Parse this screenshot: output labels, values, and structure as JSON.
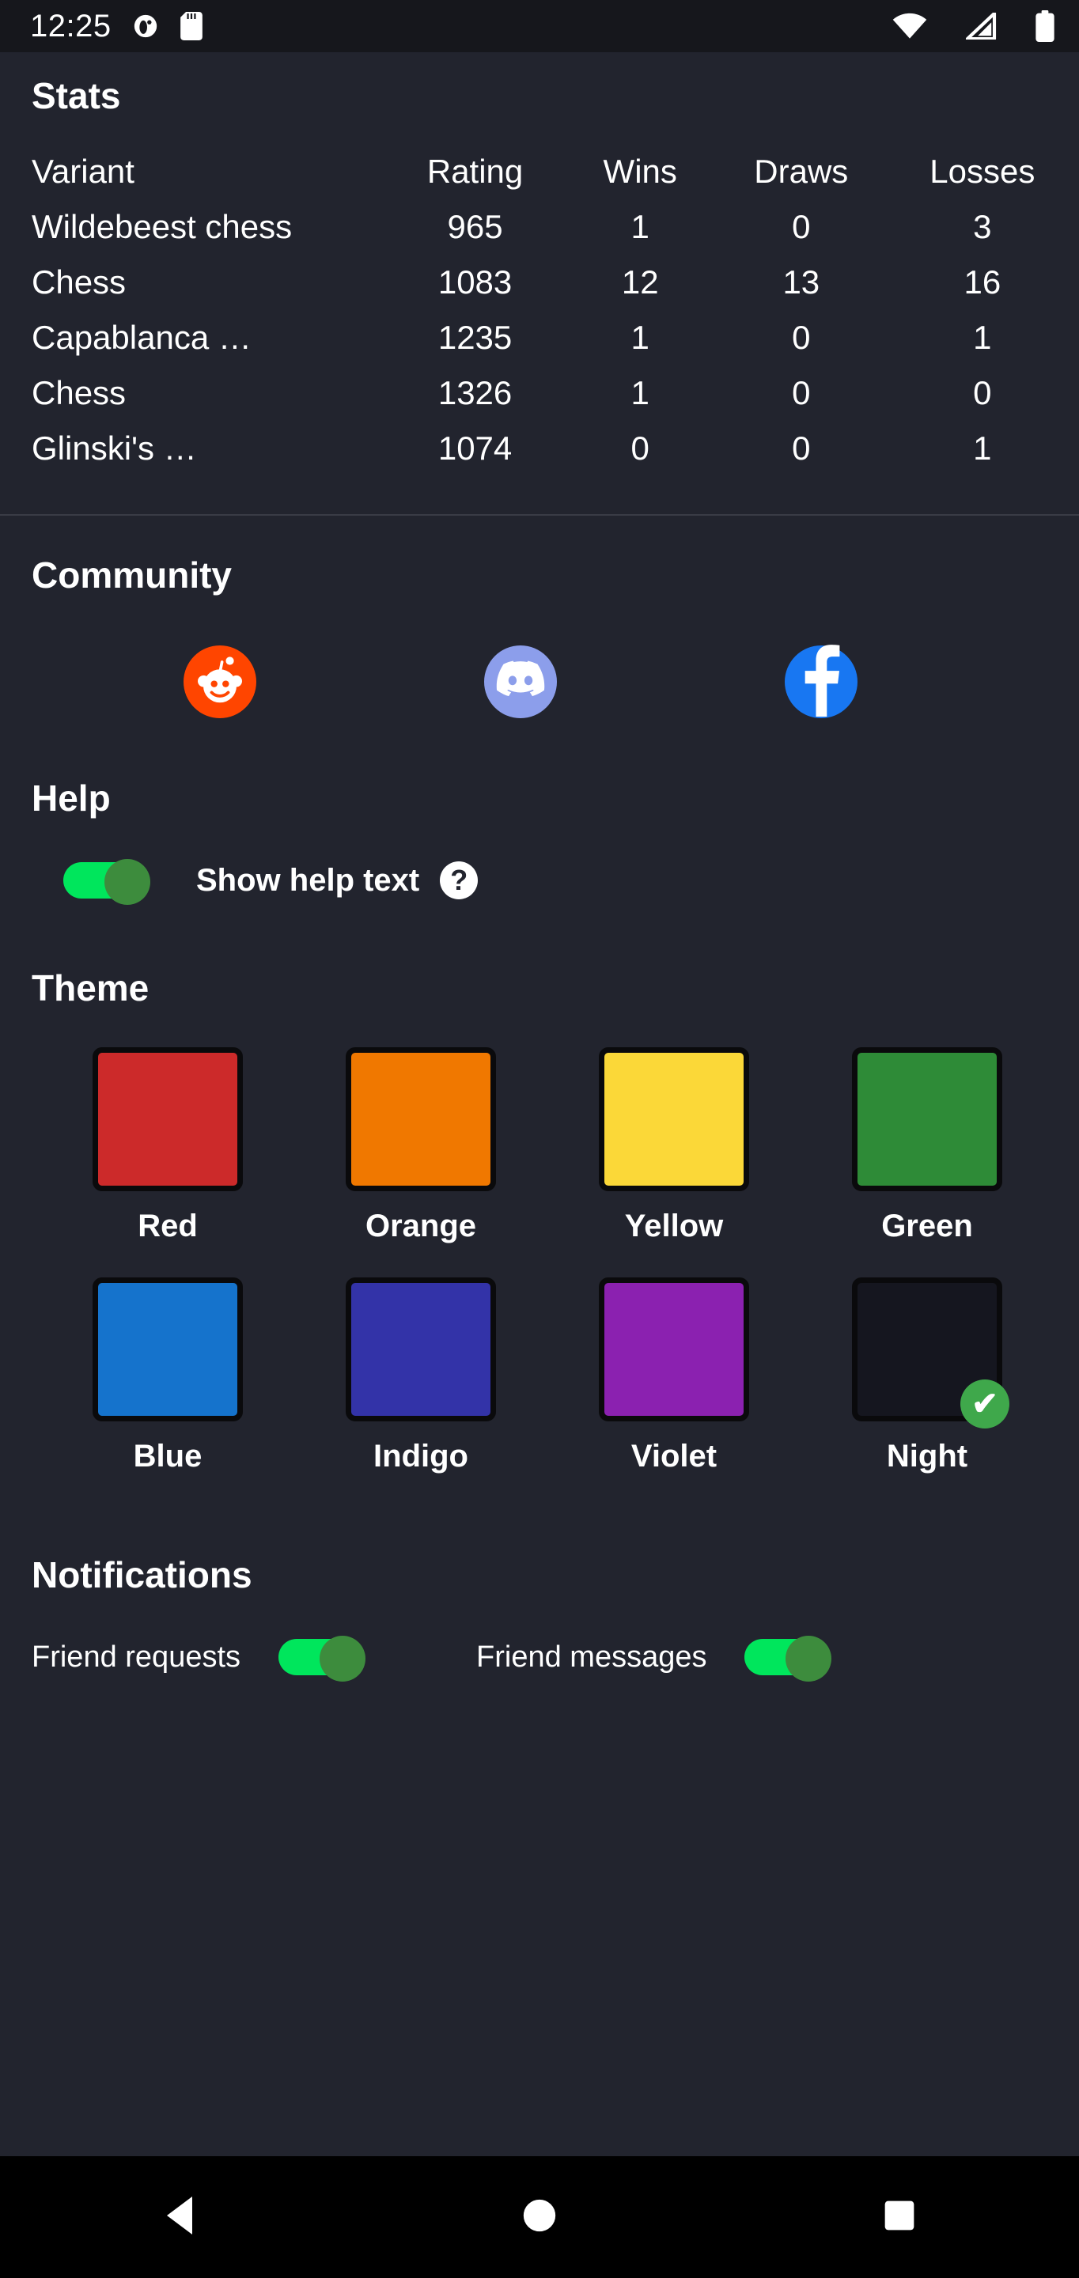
{
  "statusbar": {
    "time": "12:25",
    "icons": [
      "clock-alarm-icon",
      "sd-card-icon"
    ],
    "right_icons": [
      "wifi-icon",
      "cell-signal-icon",
      "battery-icon"
    ]
  },
  "stats": {
    "title": "Stats",
    "columns": [
      "Variant",
      "Rating",
      "Wins",
      "Draws",
      "Losses"
    ],
    "rows": [
      {
        "variant": "Wildebeest chess",
        "rating": "965",
        "wins": "1",
        "draws": "0",
        "losses": "3"
      },
      {
        "variant": "Chess",
        "rating": "1083",
        "wins": "12",
        "draws": "13",
        "losses": "16"
      },
      {
        "variant": "Capablanca …",
        "rating": "1235",
        "wins": "1",
        "draws": "0",
        "losses": "1"
      },
      {
        "variant": "Chess",
        "rating": "1326",
        "wins": "1",
        "draws": "0",
        "losses": "0"
      },
      {
        "variant": "Glinski's …",
        "rating": "1074",
        "wins": "0",
        "draws": "0",
        "losses": "1"
      }
    ]
  },
  "community": {
    "title": "Community",
    "links": [
      {
        "name": "reddit",
        "icon": "reddit-icon",
        "color": "#FF4500"
      },
      {
        "name": "discord",
        "icon": "discord-icon",
        "color": "#8C9EEB"
      },
      {
        "name": "facebook",
        "icon": "facebook-icon",
        "color": "#1877F2"
      }
    ]
  },
  "help": {
    "title": "Help",
    "toggle_label": "Show help text",
    "toggle_on": true,
    "info_icon_glyph": "?"
  },
  "theme": {
    "title": "Theme",
    "selected": "Night",
    "check_glyph": "✔",
    "swatches": [
      {
        "label": "Red",
        "color": "#CC2A2A",
        "selected": false
      },
      {
        "label": "Orange",
        "color": "#F07800",
        "selected": false
      },
      {
        "label": "Yellow",
        "color": "#FBD838",
        "selected": false
      },
      {
        "label": "Green",
        "color": "#2E8B37",
        "selected": false
      },
      {
        "label": "Blue",
        "color": "#1573CC",
        "selected": false
      },
      {
        "label": "Indigo",
        "color": "#3333A8",
        "selected": false
      },
      {
        "label": "Violet",
        "color": "#8B21B0",
        "selected": false
      },
      {
        "label": "Night",
        "color": "#15161F",
        "selected": true
      }
    ]
  },
  "notifications": {
    "title": "Notifications",
    "items": [
      {
        "label": "Friend requests",
        "on": true
      },
      {
        "label": "Friend messages",
        "on": true
      }
    ]
  },
  "navbar": {
    "buttons": [
      {
        "name": "back-button",
        "icon": "back-triangle-icon"
      },
      {
        "name": "home-button",
        "icon": "home-circle-icon"
      },
      {
        "name": "recents-button",
        "icon": "recents-square-icon"
      }
    ]
  },
  "colors": {
    "background": "#22242E",
    "statusbar": "#16171C",
    "navbar": "#000000",
    "accent_green": "#00E65C",
    "thumb_green": "#3D8C3D",
    "text": "#FFFFFF",
    "divider": "#3A3C46"
  }
}
